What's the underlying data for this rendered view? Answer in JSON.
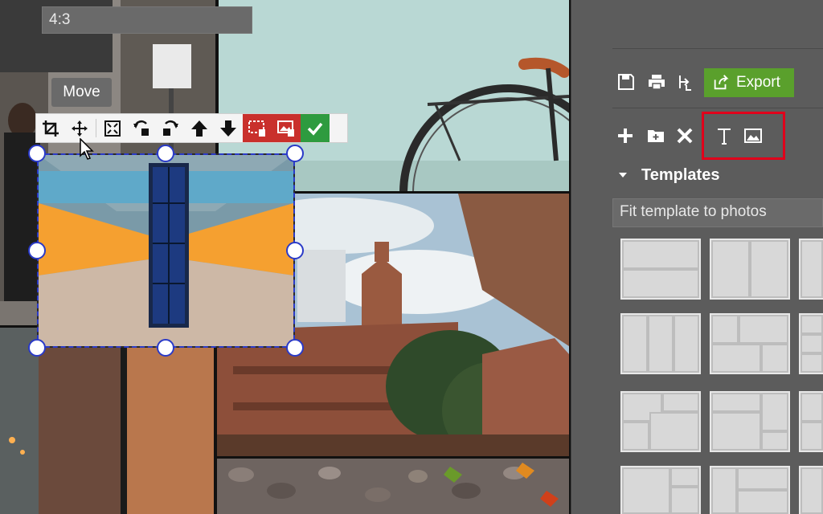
{
  "tooltip": {
    "text": "Move"
  },
  "toolbar": {
    "tools": [
      {
        "name": "crop-icon",
        "type": "normal"
      },
      {
        "name": "move-icon",
        "type": "normal"
      },
      {
        "name": "fit-icon",
        "type": "normal"
      },
      {
        "name": "rotate-left-icon",
        "type": "normal"
      },
      {
        "name": "rotate-right-icon",
        "type": "normal"
      },
      {
        "name": "bring-forward-icon",
        "type": "normal"
      },
      {
        "name": "send-backward-icon",
        "type": "normal"
      },
      {
        "name": "delete-frame-icon",
        "type": "danger"
      },
      {
        "name": "delete-photo-icon",
        "type": "danger"
      },
      {
        "name": "confirm-icon",
        "type": "success"
      }
    ]
  },
  "panel": {
    "aspect_ratio": "4:3",
    "export_label": "Export",
    "templates_title": "Templates",
    "fit_template_label": "Fit template to photos"
  },
  "colors": {
    "panel_bg": "#5c5c5c",
    "export_green": "#5aa02c",
    "selection_blue": "#2a3ac8",
    "highlight_red": "#e0001b",
    "danger_red": "#c9302c",
    "confirm_green": "#2e9b3f"
  }
}
